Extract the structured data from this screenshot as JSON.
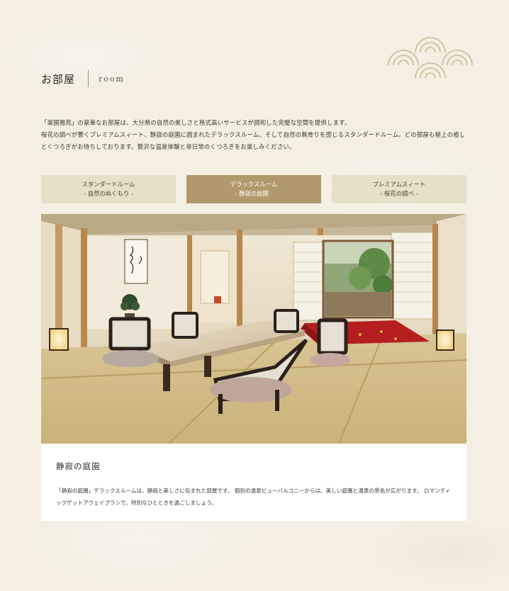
{
  "section": {
    "title_ja": "お部屋",
    "title_en": "room"
  },
  "intro": {
    "line1": "「楽園雅苑」の豪華なお部屋は、大分県の自然の美しさと格式高いサービスが調和した完璧な空間を提供します。",
    "line2": "桜花の調べが響くプレミアムスィート、静寂の庭園に囲まれたデラックスルーム、そして自然の無骨りを感じるスタンダードルーム。どの部屋も極上の癒しとくつろぎがお待ちしております。贅沢な温泉体験と非日常のくつろぎをお楽しみください。"
  },
  "tabs": [
    {
      "name": "スタンダードルーム",
      "sub": "- 自然のぬくもり -",
      "active": false
    },
    {
      "name": "デラックスルーム",
      "sub": "- 静寂の庭園 -",
      "active": true
    },
    {
      "name": "プレミアムスィート",
      "sub": "- 桜花の調べ -",
      "active": false
    }
  ],
  "room": {
    "title": "静寂の庭園",
    "description": "「静寂の庭園」デラックスルームは、静寂と美しさに包まれた部屋です。 個別の温泉ビューバルコニーからは、美しい庭園と温泉の景色が広がります。 ロマンティックゲットアウェイプランで、特別なひとときを過ごしましょう。",
    "image_icon": "room-photo"
  },
  "colors": {
    "background": "#f4efe2",
    "tab": "#e6e0c8",
    "tab_active": "#b09a6b",
    "accent_wave": "#c9b994"
  }
}
